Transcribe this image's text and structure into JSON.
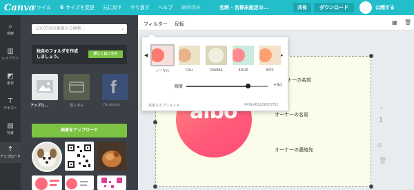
{
  "topbar": {
    "logo": "Canva",
    "menu": [
      "ファイル",
      "サイズを変更",
      "元に戻す",
      "やり直す",
      "ヘルプ",
      "保存済み"
    ],
    "doc_name": "名刺 - 名称未設定の...",
    "share_label": "共有",
    "download_label": "ダウンロード",
    "publish_label": "公開する"
  },
  "leftnav": {
    "items": [
      {
        "label": "検索",
        "icon": "search-icon"
      },
      {
        "label": "レイアウト",
        "icon": "layout-icon"
      },
      {
        "label": "素材",
        "icon": "elements-icon"
      },
      {
        "label": "テキスト",
        "icon": "text-icon"
      },
      {
        "label": "背景",
        "icon": "background-icon"
      },
      {
        "label": "アップロード",
        "icon": "upload-icon"
      }
    ]
  },
  "panel": {
    "search_placeholder": "100万点の画像から検索...",
    "promo_text_1": "独自のフォルダを作成",
    "promo_text_2": "しましょう。",
    "promo_button": "詳しくはこちら",
    "tiles": [
      "アップロ...",
      "購入済み",
      "Facebook"
    ],
    "upload_button": "画像をアップロード"
  },
  "filterbar": {
    "filter_label": "フィルター",
    "flip_label": "反転"
  },
  "filter_popup": {
    "filters": [
      {
        "label": "ノーマル",
        "color": "#f3c9c4"
      },
      {
        "label": "CALI",
        "color": "#e8dcc0"
      },
      {
        "label": "DRAMA",
        "color": "#d7d3b4"
      },
      {
        "label": "EDGE",
        "color": "#c7ead9"
      },
      {
        "label": "EPIC",
        "color": "#f0dcc2"
      }
    ],
    "blur_label": "輝度",
    "blur_value": "+50",
    "blur_level_percent": 75,
    "advanced_label": "高度なオプション",
    "hex_code": "649b481b56007f52"
  },
  "canvas": {
    "logo_text": "aibo",
    "owner_name": "オーナーの名前",
    "owner_name_2": "オーナーの名前",
    "owner_contact": "オーナーの連絡先",
    "page_number": "1"
  },
  "colors": {
    "brand": "#22bfcb",
    "upload_green": "#7cc243",
    "circle_pink": "#ff5a7a"
  }
}
